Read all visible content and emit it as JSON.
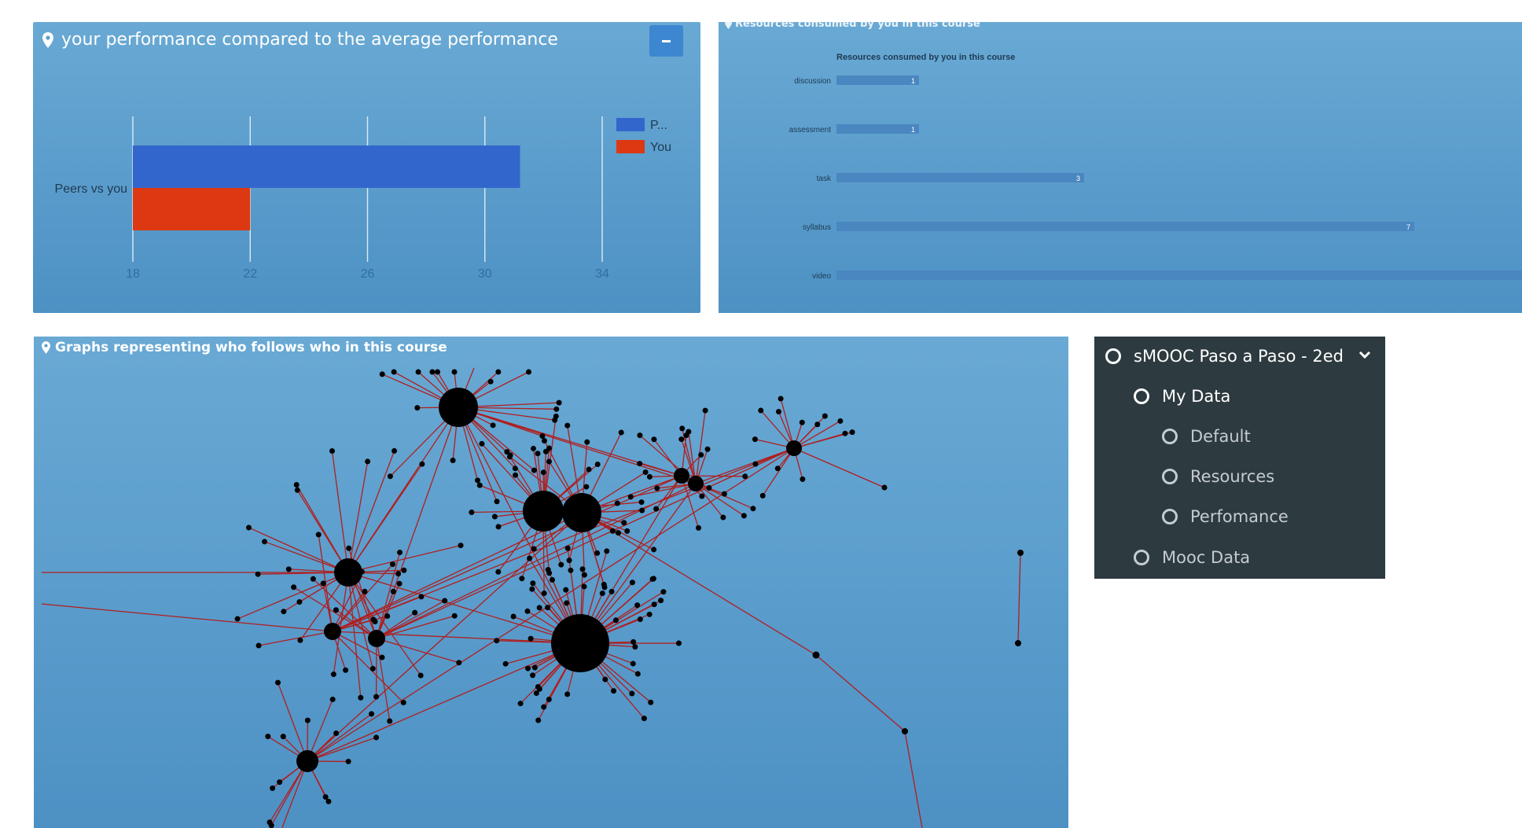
{
  "performance": {
    "title": "your performance compared to the average performance",
    "collapse_icon": "minus-icon",
    "chart_data": {
      "type": "bar",
      "orientation": "horizontal",
      "categories": [
        "Peers vs you"
      ],
      "series": [
        {
          "name": "P...",
          "values": [
            31.2
          ],
          "color": "#3366cc"
        },
        {
          "name": "You",
          "values": [
            22
          ],
          "color": "#dc3912"
        }
      ],
      "xlim": [
        18,
        34
      ],
      "xticks": [
        "18",
        "22",
        "26",
        "30",
        "34"
      ],
      "grid": true,
      "legend": "top-right"
    }
  },
  "resources": {
    "title": "Resources consumed by you in this course",
    "chart_data": {
      "type": "bar",
      "orientation": "horizontal",
      "title": "Resources consumed by you in this course",
      "categories": [
        "discussion",
        "assessment",
        "task",
        "syllabus",
        "video"
      ],
      "values": [
        1,
        1,
        3,
        7,
        9
      ],
      "value_labels": [
        "1",
        "1",
        "3",
        "7",
        ""
      ],
      "xlim": [
        0,
        7.6
      ],
      "color": "#4a86c0"
    }
  },
  "graph": {
    "title": "Graphs representing who follows who in this course"
  },
  "menu": {
    "course": "sMOOC Paso a Paso - 2ed",
    "my_data": "My Data",
    "default": "Default",
    "resources": "Resources",
    "performance": "Perfomance",
    "mooc_data": "Mooc Data",
    "expand_icon": "chevron-down-icon"
  },
  "colors": {
    "panel": "#5b9fcd",
    "edge": "#b01e1e",
    "node": "#000000",
    "menu_bg": "#2d3a40"
  }
}
